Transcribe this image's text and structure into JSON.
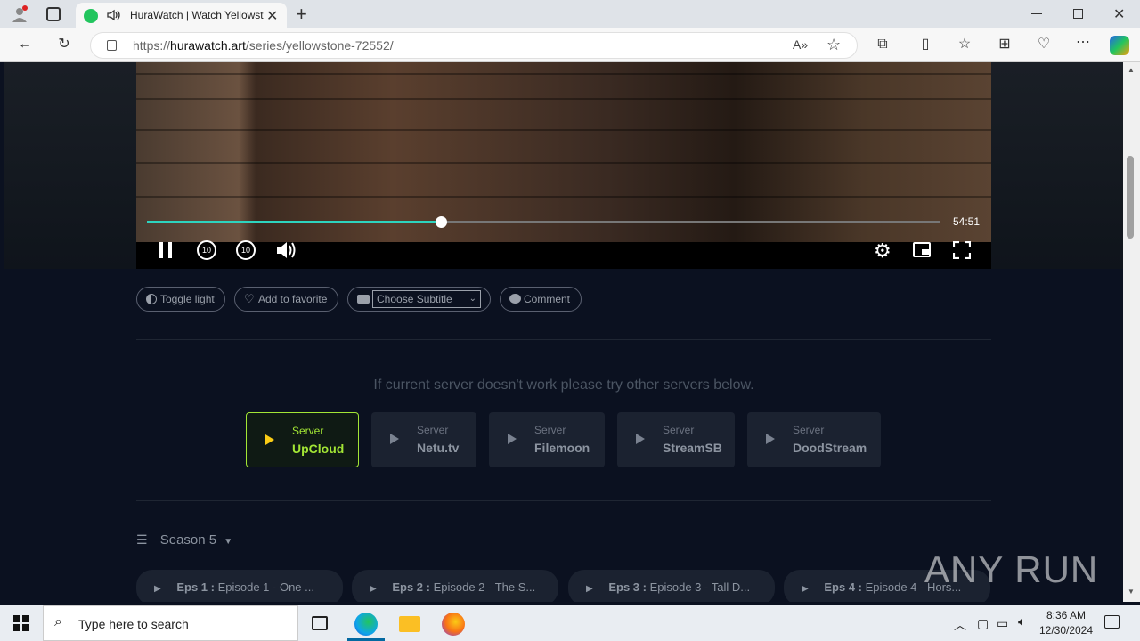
{
  "browser": {
    "tab_title": "HuraWatch | Watch Yellowst",
    "new_tab": "+",
    "url_scheme": "https://",
    "url_domain": "hurawatch.art",
    "url_path": "/series/yellowstone-72552/"
  },
  "player": {
    "progress": 0.37,
    "time_remaining": "54:51"
  },
  "actions": {
    "toggle_light": "Toggle light",
    "add_favorite": "Add to favorite",
    "subtitle_select": "Choose Subtitle",
    "comment": "Comment"
  },
  "servers": {
    "notice": "If current server doesn't work please try other servers below.",
    "label": "Server",
    "items": [
      "UpCloud",
      "Netu.tv",
      "Filemoon",
      "StreamSB",
      "DoodStream"
    ],
    "active_index": 0
  },
  "season": {
    "label": "Season 5"
  },
  "episodes": [
    {
      "num": "Eps 1 :",
      "title": "Episode 1 - One ..."
    },
    {
      "num": "Eps 2 :",
      "title": "Episode 2 - The S..."
    },
    {
      "num": "Eps 3 :",
      "title": "Episode 3 - Tall D..."
    },
    {
      "num": "Eps 4 :",
      "title": "Episode 4 - Hors..."
    }
  ],
  "watermark": "ANY RUN",
  "taskbar": {
    "search_placeholder": "Type here to search",
    "time": "8:36 AM",
    "date": "12/30/2024"
  },
  "colors": {
    "accent": "#2dd4bf",
    "server_active": "#a3e635",
    "page_bg": "#0b1120"
  }
}
